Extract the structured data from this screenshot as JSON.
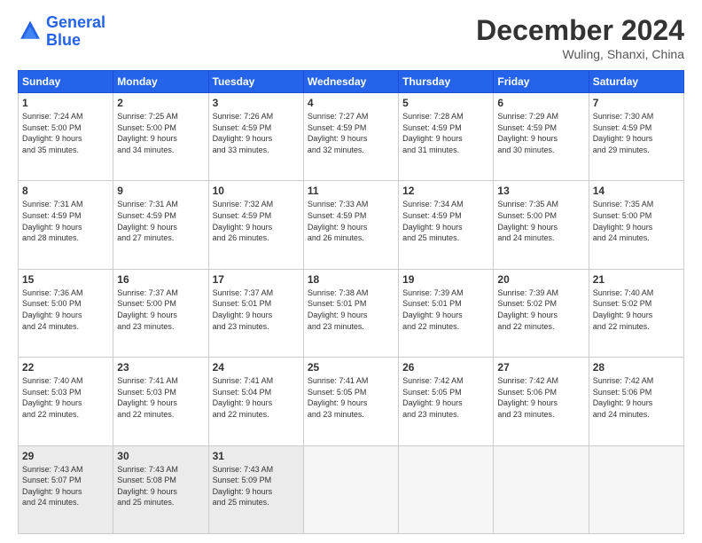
{
  "header": {
    "logo_line1": "General",
    "logo_line2": "Blue",
    "month_title": "December 2024",
    "location": "Wuling, Shanxi, China"
  },
  "weekdays": [
    "Sunday",
    "Monday",
    "Tuesday",
    "Wednesday",
    "Thursday",
    "Friday",
    "Saturday"
  ],
  "weeks": [
    [
      {
        "num": "1",
        "info": "Sunrise: 7:24 AM\nSunset: 5:00 PM\nDaylight: 9 hours\nand 35 minutes."
      },
      {
        "num": "2",
        "info": "Sunrise: 7:25 AM\nSunset: 5:00 PM\nDaylight: 9 hours\nand 34 minutes."
      },
      {
        "num": "3",
        "info": "Sunrise: 7:26 AM\nSunset: 4:59 PM\nDaylight: 9 hours\nand 33 minutes."
      },
      {
        "num": "4",
        "info": "Sunrise: 7:27 AM\nSunset: 4:59 PM\nDaylight: 9 hours\nand 32 minutes."
      },
      {
        "num": "5",
        "info": "Sunrise: 7:28 AM\nSunset: 4:59 PM\nDaylight: 9 hours\nand 31 minutes."
      },
      {
        "num": "6",
        "info": "Sunrise: 7:29 AM\nSunset: 4:59 PM\nDaylight: 9 hours\nand 30 minutes."
      },
      {
        "num": "7",
        "info": "Sunrise: 7:30 AM\nSunset: 4:59 PM\nDaylight: 9 hours\nand 29 minutes."
      }
    ],
    [
      {
        "num": "8",
        "info": "Sunrise: 7:31 AM\nSunset: 4:59 PM\nDaylight: 9 hours\nand 28 minutes."
      },
      {
        "num": "9",
        "info": "Sunrise: 7:31 AM\nSunset: 4:59 PM\nDaylight: 9 hours\nand 27 minutes."
      },
      {
        "num": "10",
        "info": "Sunrise: 7:32 AM\nSunset: 4:59 PM\nDaylight: 9 hours\nand 26 minutes."
      },
      {
        "num": "11",
        "info": "Sunrise: 7:33 AM\nSunset: 4:59 PM\nDaylight: 9 hours\nand 26 minutes."
      },
      {
        "num": "12",
        "info": "Sunrise: 7:34 AM\nSunset: 4:59 PM\nDaylight: 9 hours\nand 25 minutes."
      },
      {
        "num": "13",
        "info": "Sunrise: 7:35 AM\nSunset: 5:00 PM\nDaylight: 9 hours\nand 24 minutes."
      },
      {
        "num": "14",
        "info": "Sunrise: 7:35 AM\nSunset: 5:00 PM\nDaylight: 9 hours\nand 24 minutes."
      }
    ],
    [
      {
        "num": "15",
        "info": "Sunrise: 7:36 AM\nSunset: 5:00 PM\nDaylight: 9 hours\nand 24 minutes."
      },
      {
        "num": "16",
        "info": "Sunrise: 7:37 AM\nSunset: 5:00 PM\nDaylight: 9 hours\nand 23 minutes."
      },
      {
        "num": "17",
        "info": "Sunrise: 7:37 AM\nSunset: 5:01 PM\nDaylight: 9 hours\nand 23 minutes."
      },
      {
        "num": "18",
        "info": "Sunrise: 7:38 AM\nSunset: 5:01 PM\nDaylight: 9 hours\nand 23 minutes."
      },
      {
        "num": "19",
        "info": "Sunrise: 7:39 AM\nSunset: 5:01 PM\nDaylight: 9 hours\nand 22 minutes."
      },
      {
        "num": "20",
        "info": "Sunrise: 7:39 AM\nSunset: 5:02 PM\nDaylight: 9 hours\nand 22 minutes."
      },
      {
        "num": "21",
        "info": "Sunrise: 7:40 AM\nSunset: 5:02 PM\nDaylight: 9 hours\nand 22 minutes."
      }
    ],
    [
      {
        "num": "22",
        "info": "Sunrise: 7:40 AM\nSunset: 5:03 PM\nDaylight: 9 hours\nand 22 minutes."
      },
      {
        "num": "23",
        "info": "Sunrise: 7:41 AM\nSunset: 5:03 PM\nDaylight: 9 hours\nand 22 minutes."
      },
      {
        "num": "24",
        "info": "Sunrise: 7:41 AM\nSunset: 5:04 PM\nDaylight: 9 hours\nand 22 minutes."
      },
      {
        "num": "25",
        "info": "Sunrise: 7:41 AM\nSunset: 5:05 PM\nDaylight: 9 hours\nand 23 minutes."
      },
      {
        "num": "26",
        "info": "Sunrise: 7:42 AM\nSunset: 5:05 PM\nDaylight: 9 hours\nand 23 minutes."
      },
      {
        "num": "27",
        "info": "Sunrise: 7:42 AM\nSunset: 5:06 PM\nDaylight: 9 hours\nand 23 minutes."
      },
      {
        "num": "28",
        "info": "Sunrise: 7:42 AM\nSunset: 5:06 PM\nDaylight: 9 hours\nand 24 minutes."
      }
    ],
    [
      {
        "num": "29",
        "info": "Sunrise: 7:43 AM\nSunset: 5:07 PM\nDaylight: 9 hours\nand 24 minutes."
      },
      {
        "num": "30",
        "info": "Sunrise: 7:43 AM\nSunset: 5:08 PM\nDaylight: 9 hours\nand 25 minutes."
      },
      {
        "num": "31",
        "info": "Sunrise: 7:43 AM\nSunset: 5:09 PM\nDaylight: 9 hours\nand 25 minutes."
      },
      {
        "num": "",
        "info": ""
      },
      {
        "num": "",
        "info": ""
      },
      {
        "num": "",
        "info": ""
      },
      {
        "num": "",
        "info": ""
      }
    ]
  ]
}
